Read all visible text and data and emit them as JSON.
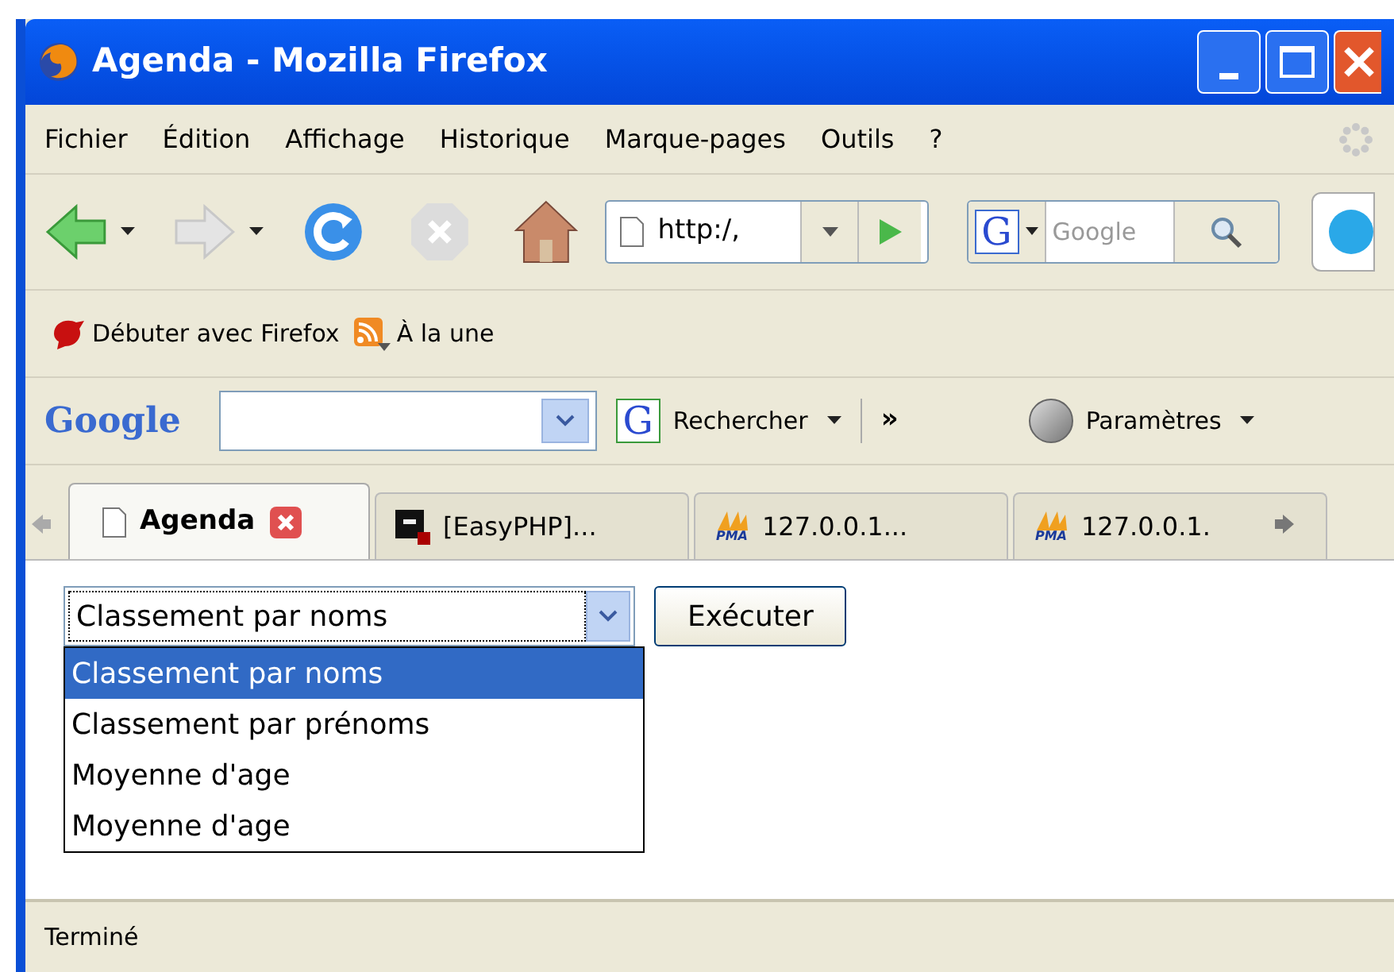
{
  "window": {
    "title": "Agenda - Mozilla Firefox"
  },
  "menu": [
    "Fichier",
    "Édition",
    "Affichage",
    "Historique",
    "Marque-pages",
    "Outils",
    "?"
  ],
  "navigation": {
    "address": "http:/,",
    "engine_letter": "G",
    "search_placeholder": "Google"
  },
  "bookmarks": [
    {
      "kind": "getting-started",
      "label": "Débuter avec Firefox"
    },
    {
      "kind": "feed",
      "label": "À la une"
    }
  ],
  "google_toolbar": {
    "logo": "Google",
    "engine_letter": "G",
    "search_button": "Rechercher",
    "more": "»",
    "settings": "Paramètres"
  },
  "tabs": [
    {
      "kind": "page",
      "label": "Agenda",
      "selected": true
    },
    {
      "kind": "easyphp",
      "label": "[EasyPHP]...",
      "selected": false
    },
    {
      "kind": "pma",
      "pma_label": "PMA",
      "label": "127.0.0.1...",
      "selected": false
    },
    {
      "kind": "pma",
      "pma_label": "PMA",
      "label": "127.0.0.1.",
      "selected": false
    }
  ],
  "form": {
    "select_value": "Classement par noms",
    "button": "Exécuter",
    "options": [
      {
        "label": "Classement par noms",
        "selected": true
      },
      {
        "label": "Classement par prénoms",
        "selected": false
      },
      {
        "label": "Moyenne d'age",
        "selected": false
      },
      {
        "label": "Moyenne d'age",
        "selected": false
      }
    ]
  },
  "status_bar": {
    "text": "Terminé"
  }
}
